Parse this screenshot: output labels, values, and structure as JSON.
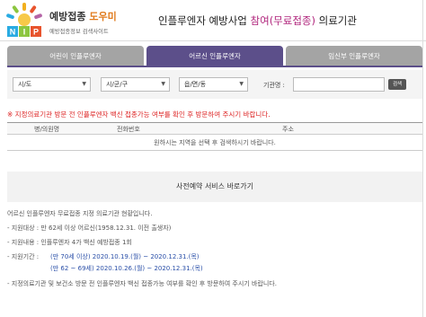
{
  "logo": {
    "title_main": "예방접종",
    "title_accent": "도우미",
    "subtitle": "예방접종정보 검색사이트",
    "letters": "NIP"
  },
  "page_title": {
    "prefix": "인플루엔자 예방사업",
    "highlight": "참여(무료접종)",
    "suffix": "의료기관"
  },
  "tabs": [
    {
      "label": "어린이 인플루엔자",
      "active": false
    },
    {
      "label": "어르신 인플루엔자",
      "active": true
    },
    {
      "label": "임신부 인플루엔자",
      "active": false
    }
  ],
  "filter": {
    "sido": "시/도",
    "sigungu": "시/군/구",
    "eupmyeondong": "읍/면/동",
    "hospital_label": "기관명 :",
    "search_button": "검색"
  },
  "notice": "※ 지정의료기관 방문 전 인플루엔자 백신 접종가능 여부를 확인 후 방문하여 주시기 바랍니다.",
  "table": {
    "headers": [
      "병/의원명",
      "전화번호",
      "주소"
    ],
    "empty_message": "원하시는 지역을 선택 후 검색하시기 바랍니다."
  },
  "reservation": "사전예약 서비스 바로가기",
  "info": {
    "intro": "어르신 인플루엔자 무료접종 지정 의료기관 현황입니다.",
    "target": "- 지원대상 : 만 62세 이상 어르신(1958.12.31. 이전 출생자)",
    "content": "- 지원내용 : 인플루엔자 4가 백신 예방접종 1회",
    "period_label": "- 지원기간 :",
    "period_1": "(만 70세 이상) 2020.10.19.(월) ~ 2020.12.31.(목)",
    "period_2": "(만 62 ~ 69세) 2020.10.26.(월) ~ 2020.12.31.(목)",
    "bottom_notice": "- 지정의료기관 및 보건소 방문 전 인플루엔자 백신 접종가능 여부를 확인 후 방문하여 주시기 바랍니다."
  },
  "colors": {
    "tab_active": "#5c4f8a",
    "tab_inactive": "#a4a4a4",
    "notice_red": "#dd2222",
    "highlight_pink": "#b0257c",
    "date_blue": "#2a4fa8"
  }
}
